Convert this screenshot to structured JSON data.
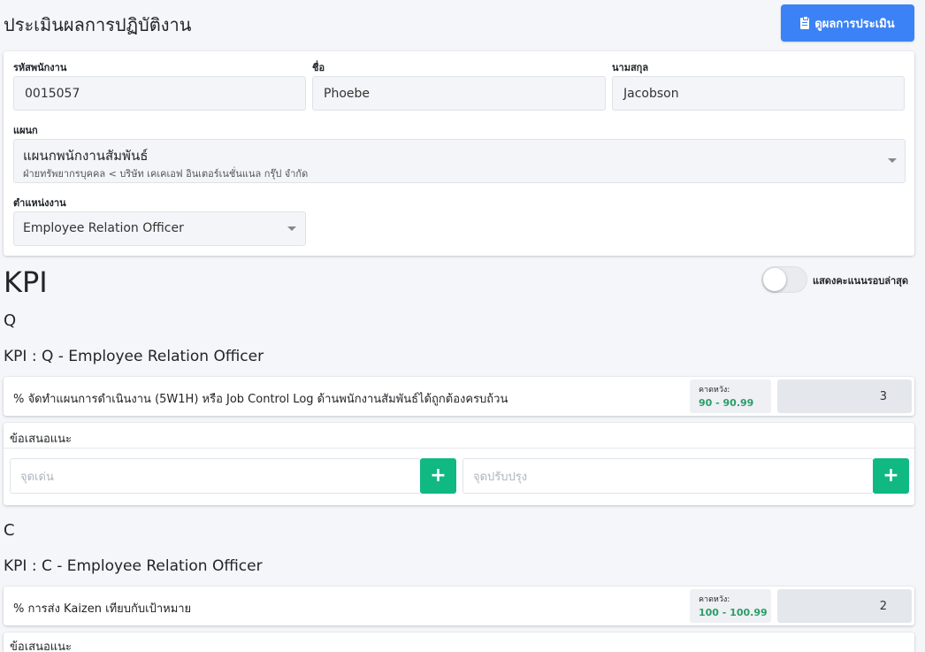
{
  "header": {
    "title": "ประเมินผลการปฏิบัติงาน",
    "view_results_button": "ดูผลการประเมิน",
    "view_results_icon": "clipboard-icon"
  },
  "employee": {
    "id_label": "รหัสพนักงาน",
    "id_value": "0015057",
    "first_name_label": "ชื่อ",
    "first_name_value": "Phoebe",
    "last_name_label": "นามสกุล",
    "last_name_value": "Jacobson",
    "department_label": "แผนก",
    "department_value": "แผนกพนักงานสัมพันธ์",
    "department_path": "ฝ่ายทรัพยากรบุคคล < บริษัท เคเคเอฟ อินเตอร์เนชั่นแนล กรุ๊ป จำกัด",
    "position_label": "ตำแหน่งงาน",
    "position_value": "Employee Relation Officer"
  },
  "kpi": {
    "heading": "KPI",
    "toggle_label": "แสดงคะแนนรอบล่าสุด",
    "toggle_on": false,
    "sections": [
      {
        "letter": "Q",
        "title": "KPI : Q - Employee Relation Officer",
        "item": "% จัดทำแผนการดำเนินงาน (5W1H) หรือ Job Control Log ด้านพนักงานสัมพันธ์ได้ถูกต้องครบถ้วน",
        "expect_label": "คาดหวัง:",
        "expect_range": "90 - 90.99",
        "score": "3",
        "suggest_title": "ข้อเสนอแนะ",
        "strength_placeholder": "จุดเด่น",
        "improve_placeholder": "จุดปรับปรุง",
        "add_label": "+"
      },
      {
        "letter": "C",
        "title": "KPI : C - Employee Relation Officer",
        "item": "% การส่ง Kaizen เทียบกับเป้าหมาย",
        "expect_label": "คาดหวัง:",
        "expect_range": "100 - 100.99",
        "score": "2",
        "suggest_title": "ข้อเสนอแนะ"
      }
    ]
  },
  "colors": {
    "primary": "#3b82f6",
    "success": "#10b981",
    "expect_text": "#2a9d6a"
  }
}
